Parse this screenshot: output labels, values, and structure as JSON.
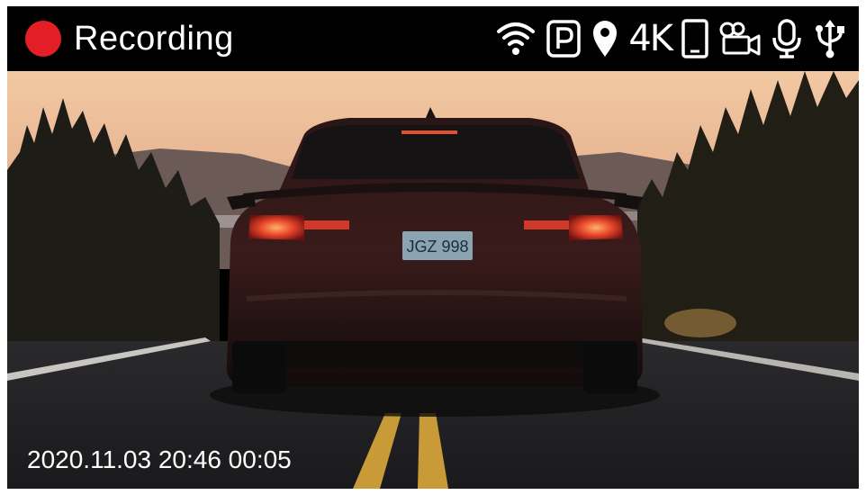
{
  "status": {
    "recording_label": "Recording",
    "recording_color": "#e31e24",
    "icons": [
      "wifi-icon",
      "parking-mode-icon",
      "gps-location-icon",
      "4k-resolution-icon",
      "phone-icon",
      "camera-icon",
      "microphone-icon",
      "usb-icon"
    ],
    "resolution_label": "4K"
  },
  "overlay": {
    "timestamp": "2020.11.03 20:46 00:05"
  },
  "scene": {
    "license_plate": "JGZ 998"
  }
}
